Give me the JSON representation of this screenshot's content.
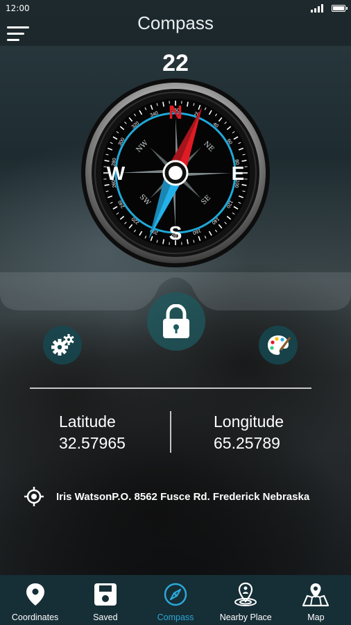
{
  "status_bar": {
    "time": "12:00"
  },
  "app_bar": {
    "title": "Compass"
  },
  "heading": {
    "degrees": "22"
  },
  "compass": {
    "cardinals": {
      "n": "N",
      "e": "E",
      "s": "S",
      "w": "W"
    },
    "intercardinals": {
      "ne": "NE",
      "se": "SE",
      "sw": "SW",
      "nw": "NW"
    },
    "ticks": [
      "20",
      "40",
      "60",
      "80",
      "100",
      "120",
      "140",
      "160",
      "180",
      "200",
      "220",
      "240",
      "260",
      "280",
      "300",
      "320",
      "340",
      "360"
    ],
    "colors": {
      "north": "#e01b24",
      "south": "#24b0e8",
      "ring": "#1fa9d9",
      "bezel": "#c9c9c9"
    }
  },
  "actions": {
    "lock_icon": "lock-icon",
    "settings_icon": "gears-icon",
    "theme_icon": "palette-icon"
  },
  "location": {
    "latitude_label": "Latitude",
    "latitude_value": "32.57965",
    "longitude_label": "Longitude",
    "longitude_value": "65.25789",
    "address": "Iris WatsonP.O. 8562 Fusce Rd. Frederick Nebraska"
  },
  "bottom_nav": {
    "items": [
      {
        "label": "Coordinates",
        "icon": "map-pin-icon"
      },
      {
        "label": "Saved",
        "icon": "save-icon"
      },
      {
        "label": "Compass",
        "icon": "compass-icon",
        "active": true
      },
      {
        "label": "Nearby Place",
        "icon": "nearby-place-icon"
      },
      {
        "label": "Map",
        "icon": "map-icon"
      }
    ],
    "active_color": "#2ba8d8"
  }
}
